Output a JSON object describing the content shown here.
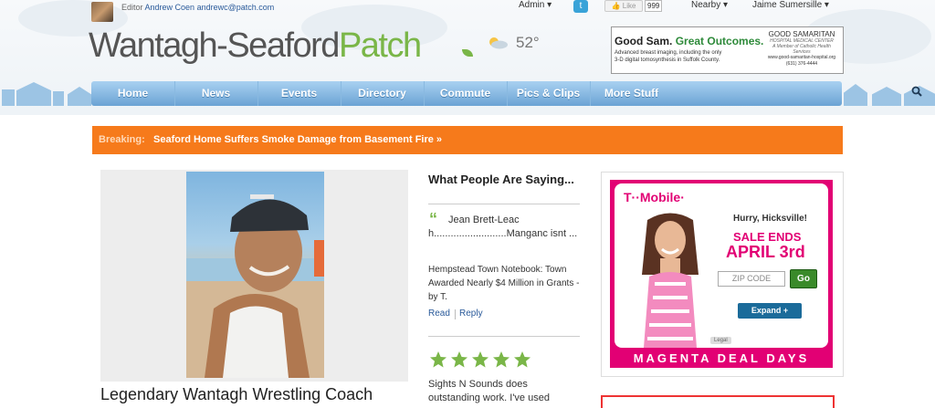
{
  "header": {
    "editor_label": "Editor",
    "editor_name": "Andrew Coen",
    "editor_email": "andrewc@patch.com",
    "admin_menu": "Admin",
    "like_label": "Like",
    "like_count": "999",
    "nearby_menu": "Nearby",
    "user_menu": "Jaime Sumersille",
    "logo_main": "Wantagh-Seaford",
    "logo_accent": "Patch",
    "temperature": "52°"
  },
  "top_ad": {
    "headline_a": "Good Sam.",
    "headline_b": "Great Outcomes.",
    "line1": "Advanced breast imaging, including the only",
    "line2": "3-D digital tomosynthesis in Suffolk County.",
    "brand": "GOOD SAMARITAN",
    "brand_sub": "HOSPITAL MEDICAL CENTER",
    "brand_tag": "A Member of Catholic Health Services",
    "url": "www.good-samaritan-hospital.org",
    "phone": "(631) 376-4444"
  },
  "nav": {
    "items": [
      "Home",
      "News",
      "Events",
      "Directory",
      "Commute",
      "Pics & Clips",
      "More Stuff"
    ]
  },
  "breaking": {
    "label": "Breaking:",
    "headline": "Seaford Home Suffers Smoke Damage from Basement Fire »"
  },
  "feature": {
    "headline": "Legendary Wantagh Wrestling Coach"
  },
  "sidebar": {
    "title": "What People Are Saying...",
    "comment_author": "Jean Brett-Leach..........................Manganc isnt ...",
    "comment_link": "Hempstead Town Notebook: Town Awarded Nearly $4 Million in Grants -by T.",
    "read_label": "Read",
    "reply_label": "Reply",
    "rating": 5,
    "review_text": "Sights N Sounds does outstanding work. I've used"
  },
  "tmobile_ad": {
    "brand": "T··Mobile·",
    "hurry": "Hurry, Hicksville!",
    "sale": "SALE ENDS",
    "date": "APRIL 3rd",
    "zip_placeholder": "ZIP CODE",
    "go_label": "Go",
    "expand_label": "Expand +",
    "legal_label": "Legal",
    "deal": "MAGENTA DEAL DAYS",
    "magenta": "#e20074"
  },
  "colors": {
    "patch_green": "#7ab648",
    "nav_blue": "#7fb2dd",
    "breaking_orange": "#f67a1b"
  }
}
